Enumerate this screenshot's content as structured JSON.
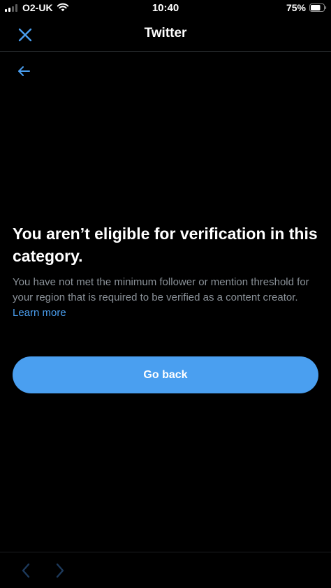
{
  "status_bar": {
    "carrier": "O2-UK",
    "time": "10:40",
    "battery_percent": "75%",
    "battery_level": 0.75,
    "signal_bars_filled": 2,
    "signal_bars_total": 4,
    "icons": [
      "signal-icon",
      "wifi-icon",
      "battery-icon"
    ]
  },
  "header": {
    "title": "Twitter",
    "close_icon": "close-icon"
  },
  "back_icon": "arrow-left-icon",
  "main": {
    "heading": "You aren’t eligible for verification in this category.",
    "description": "You have not met the minimum follower or mention threshold for your region that is required to be verified as a content creator.",
    "learn_more": "Learn more",
    "button_label": "Go back"
  },
  "bottom_bar": {
    "back_icon": "chevron-left-icon",
    "forward_icon": "chevron-right-icon"
  },
  "colors": {
    "background": "#000000",
    "accent": "#4a9ff0",
    "primary_text": "#ffffff",
    "secondary_text": "#8b9299",
    "disabled_icon": "#1d3a5c"
  }
}
